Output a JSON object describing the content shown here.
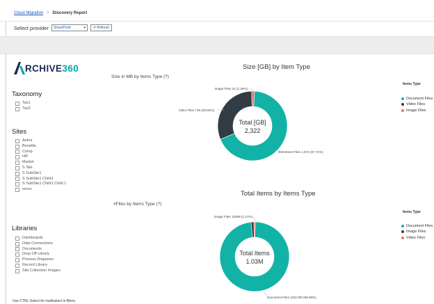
{
  "breadcrumb": {
    "parent": "Cloud Migration",
    "separator": ">",
    "current": "Discovery Report"
  },
  "toolbar": {
    "label": "Select provider",
    "provider_value": "SharePoint",
    "refresh_label": "Refresh"
  },
  "logo": {
    "text_main": "RCHIVE",
    "text_num": "360",
    "mark": "A"
  },
  "filters": {
    "taxonomy": {
      "title": "Taxonomy",
      "items": [
        "Tax1",
        "Tax2"
      ]
    },
    "sites": {
      "title": "Sites",
      "items": [
        "Aetna",
        "Benefits",
        "Comp",
        "HR",
        "Market",
        "S Site",
        "S SubSite1",
        "S SubSite1 Child1",
        "S SubSite1 Child1 Child 1",
        "xerox"
      ]
    },
    "libraries": {
      "title": "Libraries",
      "items": [
        "Dashboards",
        "Data Connections",
        "Documents",
        "Drop Off Library",
        "Process Diagrams",
        "Record Library",
        "Site Collection Images"
      ]
    }
  },
  "footer_tip": "Use CTRL-Select for multiselect in filters.",
  "colors": {
    "teal": "#12b3a6",
    "dark": "#323c44",
    "red": "#e8716f",
    "brand_navy": "#1d2952",
    "brand_teal": "#00a89f"
  },
  "chart_data": [
    {
      "type": "pie",
      "title": "Size [GB] by Item Type",
      "subtitle": "Size in MB by Items Type (?)",
      "center_label": "Total [GB]",
      "center_value": "2,322",
      "legend_title": "Items Type",
      "legend": [
        "Document Files",
        "Video Files",
        "Image Files"
      ],
      "slices": [
        {
          "name": "Document Files",
          "value": 1572,
          "percent": 67.71,
          "label": "Document Files 1,572 (67.71%)",
          "color": "#12b3a6"
        },
        {
          "name": "Video Files",
          "value": 718,
          "percent": 30.94,
          "label": "Video Files 718 (30.94%)",
          "color": "#323c44"
        },
        {
          "name": "Image Files",
          "value": 31,
          "percent": 1.35,
          "label": "Image Files 31 (1.35%)",
          "color": "#e8716f"
        }
      ]
    },
    {
      "type": "pie",
      "title": "Total Items by Items Type",
      "subtitle": "#Files by Items Type (?)",
      "center_label": "Total Items",
      "center_value": "1.03M",
      "legend_title": "Items Type",
      "legend": [
        "Document Files",
        "Image Files",
        "Video Files"
      ],
      "slices": [
        {
          "name": "Document Files",
          "value": 1011780,
          "percent": 98.08,
          "label": "Document Files 1011780 (98.08%)",
          "color": "#12b3a6"
        },
        {
          "name": "Image Files",
          "value": 13068,
          "percent": 1.27,
          "label": "Image Files 13068 (1.27%)",
          "color": "#323c44"
        },
        {
          "name": "Video Files",
          "value": 6705,
          "percent": 0.65,
          "label": "",
          "color": "#e8716f"
        }
      ]
    }
  ]
}
